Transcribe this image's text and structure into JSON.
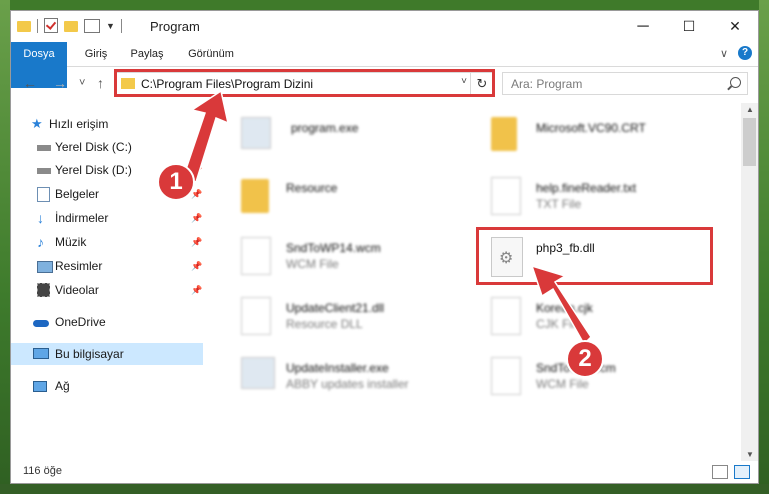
{
  "window": {
    "title": "Program",
    "minimize": "─",
    "maximize": "☐",
    "close": "✕"
  },
  "ribbon": {
    "tabs": [
      "Dosya",
      "Giriş",
      "Paylaş",
      "Görünüm"
    ],
    "expand_icon": "chevron-down-icon",
    "help": "?"
  },
  "navigation": {
    "back": "←",
    "forward": "→",
    "recent": "˅",
    "up": "↑"
  },
  "address_bar": {
    "path": "C:\\Program Files\\Program Dizini",
    "dropdown": "˅",
    "refresh": "↻"
  },
  "search": {
    "placeholder": "Ara: Program"
  },
  "sidebar": {
    "items": [
      {
        "label": "Hızlı erişim",
        "icon": "star-icon",
        "pinned": false
      },
      {
        "label": "Yerel Disk (C:)",
        "icon": "drive-icon",
        "pinned": false
      },
      {
        "label": "Yerel Disk (D:)",
        "icon": "drive-icon",
        "pinned": true
      },
      {
        "label": "Belgeler",
        "icon": "documents-icon",
        "pinned": true
      },
      {
        "label": "İndirmeler",
        "icon": "download-icon",
        "pinned": true
      },
      {
        "label": "Müzik",
        "icon": "music-icon",
        "pinned": true
      },
      {
        "label": "Resimler",
        "icon": "pictures-icon",
        "pinned": true
      },
      {
        "label": "Videolar",
        "icon": "video-icon",
        "pinned": true
      },
      {
        "label": "OneDrive",
        "icon": "cloud-icon",
        "pinned": false
      },
      {
        "label": "Bu bilgisayar",
        "icon": "computer-icon",
        "pinned": false,
        "selected": true
      },
      {
        "label": "Ağ",
        "icon": "network-icon",
        "pinned": false
      }
    ],
    "pin_glyph": "📌"
  },
  "files": [
    {
      "name": "program.exe",
      "desc": "",
      "icon": "exe-icon"
    },
    {
      "name": "Microsoft.VC90.CRT",
      "desc": "",
      "icon": "folder-icon"
    },
    {
      "name": "Resource",
      "desc": "",
      "icon": "folder-icon"
    },
    {
      "name": "help.fineReader.txt",
      "desc": "TXT File",
      "icon": "text-file-icon"
    },
    {
      "name": "SndToWP14.wcm",
      "desc": "WCM File",
      "icon": "file-icon"
    },
    {
      "name": "php3_fb.dll",
      "desc": "",
      "icon": "dll-icon"
    },
    {
      "name": "UpdateClient21.dll",
      "desc": "Resource DLL",
      "icon": "dll-icon"
    },
    {
      "name": "Korean.cjk",
      "desc": "CJK File",
      "icon": "file-icon"
    },
    {
      "name": "UpdateInstaller.exe",
      "desc": "ABBY updates installer",
      "icon": "exe-icon"
    },
    {
      "name": "SndToWP.wcm",
      "desc": "WCM File",
      "icon": "file-icon"
    }
  ],
  "status": {
    "count": "116 öğe"
  },
  "annotations": {
    "step1": "1",
    "step2": "2",
    "accent": "#d9393a"
  },
  "colors": {
    "file_tab": "#1979ca",
    "selection": "#cce8ff",
    "folder": "#f1c24a"
  }
}
